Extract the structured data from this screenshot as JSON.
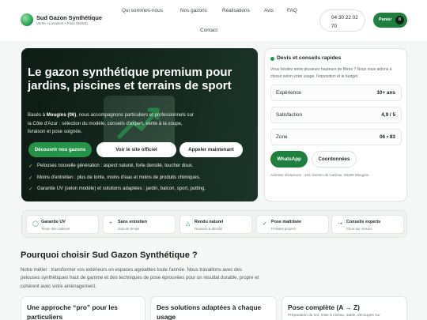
{
  "brand": {
    "name": "Sud Gazon Synthétique",
    "tagline": "Vente • Livraison • Pose (06/83)"
  },
  "nav": [
    "Qui sommes-nous",
    "Nos gazons",
    "Réalisations",
    "Avis",
    "FAQ",
    "Contact"
  ],
  "phone": {
    "line1": "04 30 22 02",
    "line2": "70"
  },
  "cart": {
    "label": "Panier",
    "count": "0"
  },
  "hero": {
    "title": "Le gazon synthétique premium pour jardins, piscines et terrains de sport",
    "desc_before": "Basés à ",
    "desc_place": "Mougins (06)",
    "desc_after": ", nous accompagnons particuliers et professionnels sur la Côte d'Azur : sélection du modèle, conseils d'expert, vente à la coupe, livraison et pose soignée.",
    "buttons": [
      "Découvrir nos gazons",
      "Voir le site officiel",
      "Appeler maintenant"
    ],
    "bullets": [
      "Pelouses nouvelle génération : aspect naturel, forte densité, toucher doux.",
      "Moins d'entretien : plus de tonte, moins d'eau et moins de produits chimiques.",
      "Garantie UV (selon modèle) et solutions adaptées : jardin, balcon, sport, putting."
    ]
  },
  "quote": {
    "title": "Devis et conseils rapides",
    "desc": "Vous hésitez entre plusieurs hauteurs de fibres ? Nous vous aidons à choisir selon votre usage, l'exposition et le budget.",
    "stats": [
      {
        "label": "Expérience",
        "value": "10+ ans"
      },
      {
        "label": "Satisfaction",
        "value": "4,9 / 5"
      },
      {
        "label": "Zone",
        "value": "06 • 83"
      }
    ],
    "whatsapp": "WhatsApp",
    "coords": "Coordonnées",
    "address": "Adresse showroom : 444 chemin de Carimai, 06250 Mougins."
  },
  "features": [
    {
      "icon": "shield-icon",
      "glyph": "◯",
      "title": "Garantie UV",
      "sub": "Tenue des couleurs"
    },
    {
      "icon": "plus-icon",
      "glyph": "+",
      "title": "Sans entretien",
      "sub": "Gain de temps"
    },
    {
      "icon": "triangle-icon",
      "glyph": "△",
      "title": "Rendu naturel",
      "sub": "Nuances & densité"
    },
    {
      "icon": "check-icon",
      "glyph": "✓",
      "title": "Pose maîtrisée",
      "sub": "Finitions propres"
    },
    {
      "icon": "arrow-icon",
      "glyph": "➝",
      "title": "Conseils experts",
      "sub": "Choix sur mesure"
    }
  ],
  "why": {
    "title": "Pourquoi choisir Sud Gazon Synthétique ?",
    "text": "Notre métier : transformer vos extérieurs en espaces agréables toute l'année. Nous travaillons avec des pelouses synthétiques haut de gamme et des techniques de pose éprouvées pour un résultat durable, propre et cohérent avec votre aménagement.",
    "cards": [
      {
        "title": "Une approche “pro” pour les particuliers",
        "sub": ""
      },
      {
        "title": "Des solutions adaptées à chaque usage",
        "sub": ""
      },
      {
        "title": "Pose complète (A → Z)",
        "sub": "Préparation du sol, mise à niveau, sable, découpes sur"
      }
    ]
  },
  "colors": {
    "accent": "#1f7f3f",
    "hero_bg": "#13261c",
    "gold": "#e3b841"
  }
}
